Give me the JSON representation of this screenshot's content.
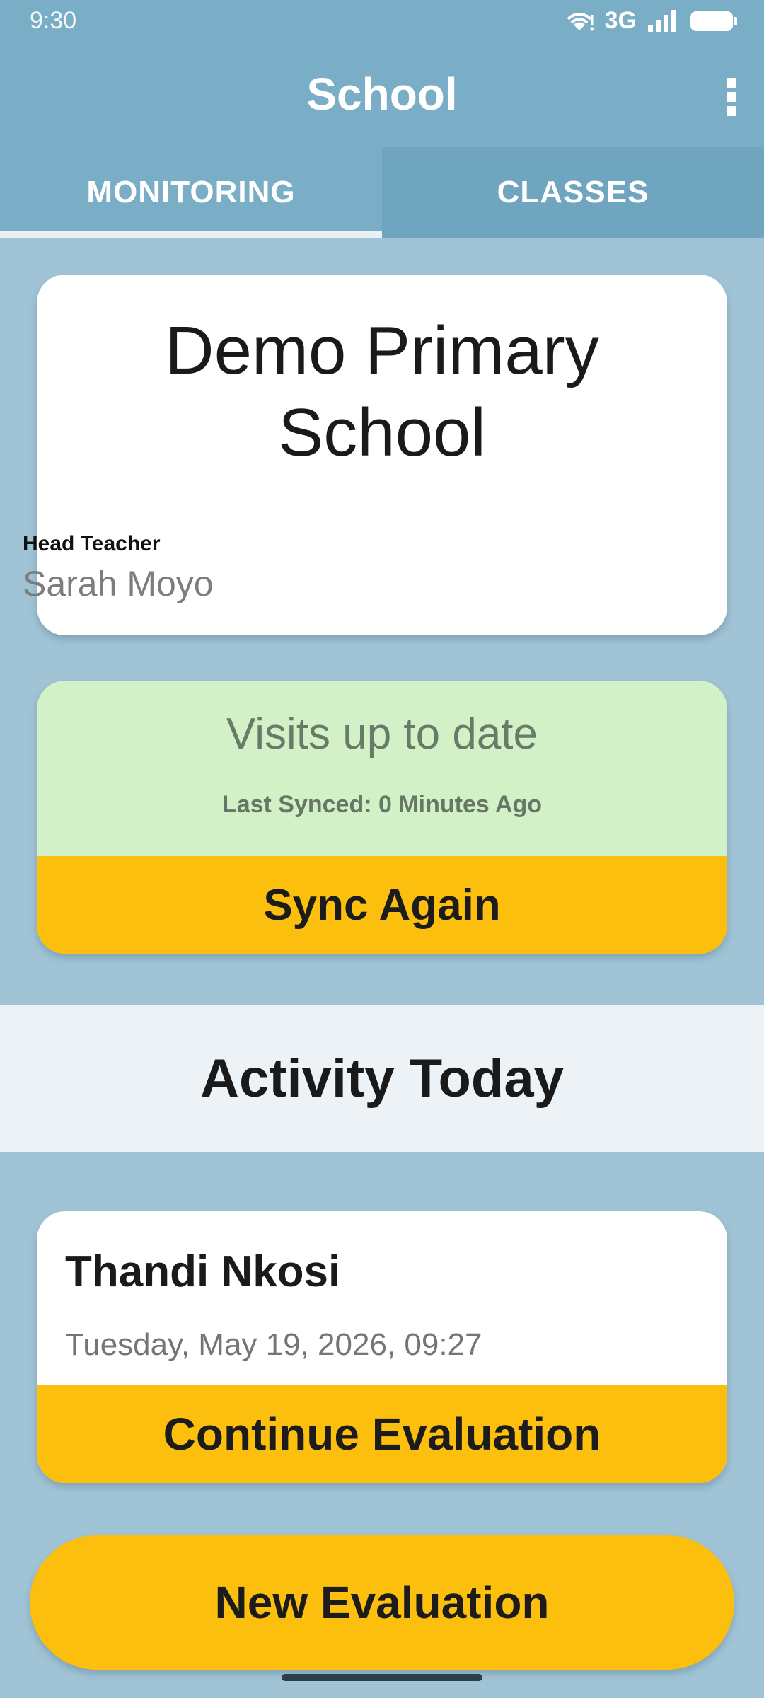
{
  "status_bar": {
    "time": "9:30",
    "network": "3G",
    "icons": [
      "wifi-icon",
      "signal-icon",
      "battery-icon"
    ]
  },
  "app_bar": {
    "title": "School",
    "menu_icon": "overflow-menu-icon"
  },
  "tabs": [
    {
      "label": "MONITORING",
      "selected": true
    },
    {
      "label": "CLASSES",
      "selected": false
    }
  ],
  "school": {
    "name": "Demo Primary School",
    "head_teacher_label": "Head Teacher",
    "head_teacher_name": "Sarah Moyo"
  },
  "sync": {
    "status": "Visits up to date",
    "last_synced": "Last Synced: 0 Minutes Ago",
    "button_label": "Sync Again"
  },
  "activity": {
    "section_title": "Activity Today",
    "items": [
      {
        "name": "Thandi Nkosi",
        "datetime": "Tuesday, May 19, 2026, 09:27",
        "button_label": "Continue Evaluation"
      }
    ]
  },
  "new_evaluation_label": "New Evaluation",
  "colors": {
    "app_bar": "#7aaec6",
    "background": "#a0c4d6",
    "accent": "#fdbf0e",
    "sync_ok": "#d2f1c7"
  }
}
